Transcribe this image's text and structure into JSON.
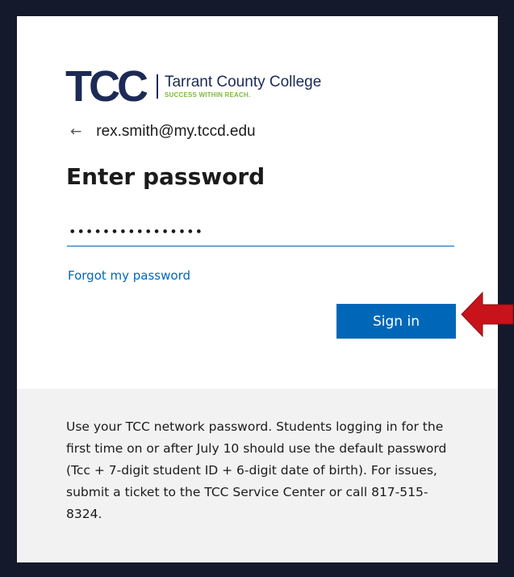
{
  "logo": {
    "mark": "TCC",
    "name": "Tarrant County College",
    "tagline": "SUCCESS WITHIN REACH."
  },
  "identity": {
    "back_icon": "arrow-left-icon",
    "email": "rex.smith@my.tccd.edu"
  },
  "title": "Enter password",
  "password": {
    "value": "••••••••••••••••"
  },
  "forgot_link": "Forgot my password",
  "signin_label": "Sign in",
  "footer": {
    "text": "Use your TCC network password. Students logging in for the first time on or after July 10 should use the default password (Tcc + 7-digit student ID + 6-digit date of birth). For issues, submit a ticket to the TCC Service Center or call 817-515-8324."
  },
  "colors": {
    "frame": "#14192b",
    "brand_navy": "#1c2a55",
    "brand_green": "#7fb83d",
    "accent_blue": "#0067b8",
    "callout_red": "#c8131b",
    "footer_bg": "#f2f2f2"
  },
  "annotation": {
    "icon": "pointer-arrow-icon"
  }
}
